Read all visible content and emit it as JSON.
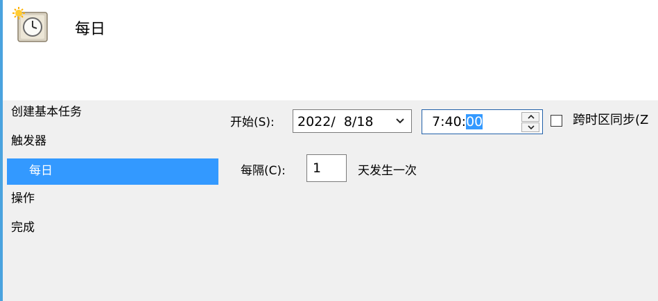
{
  "header": {
    "title": "每日",
    "icon": "task-clock-icon"
  },
  "nav": {
    "items": [
      {
        "label": "创建基本任务"
      },
      {
        "label": "触发器"
      },
      {
        "label": "每日",
        "selected": true
      },
      {
        "label": "操作"
      },
      {
        "label": "完成"
      }
    ]
  },
  "form": {
    "start_label": "开始(S):",
    "date_value": "2022/  8/18",
    "time_prefix": "7:40:",
    "time_selected": "00",
    "sync_label": "跨时区同步(Z",
    "interval_label": "每隔(C):",
    "interval_value": "1",
    "interval_suffix": "天发生一次"
  },
  "colors": {
    "accent": "#3399ff",
    "panel_bg": "#f0f0f0",
    "left_edge": "#4aa3df"
  }
}
